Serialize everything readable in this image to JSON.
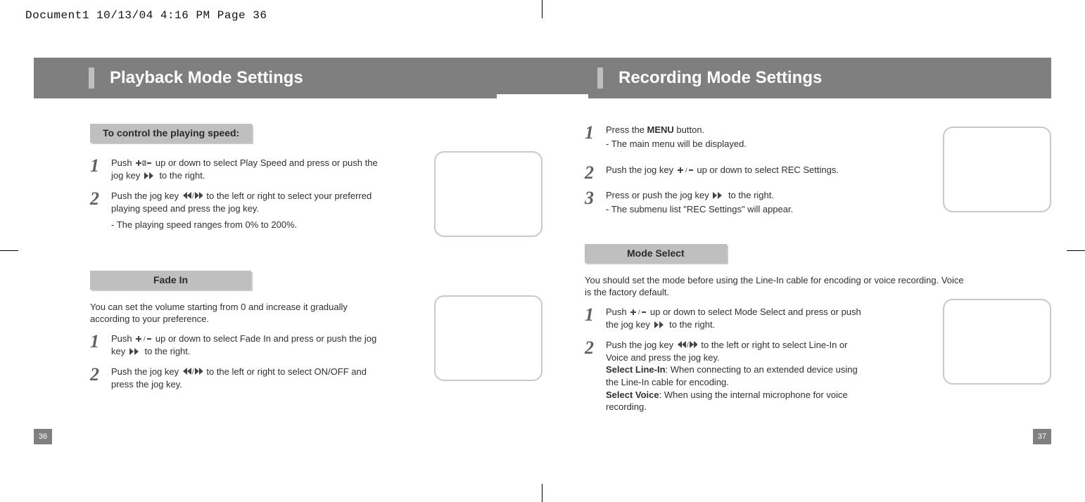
{
  "imposition_header": "Document1  10/13/04  4:16 PM  Page 36",
  "left": {
    "title": "Playback Mode Settings",
    "subhead1": "To control the playing speed:",
    "step1_num": "1",
    "step1_a": "Push ",
    "step1_b": " up or down to select Play Speed and press or push the jog key ",
    "step1_c": " to the right.",
    "step2_num": "2",
    "step2_a": "Push the jog key ",
    "step2_b": " to the left or right to select your preferred playing speed and press the jog key.",
    "step2_note": "- The playing speed ranges from 0% to 200%.",
    "subhead2": "Fade In",
    "fade_intro": "You can set the volume starting from 0 and increase it gradually according to your preference.",
    "fstep1_num": "1",
    "fstep1_a": "Push ",
    "fstep1_b": " up or down to select Fade In and press or push the jog key ",
    "fstep1_c": " to the right.",
    "fstep2_num": "2",
    "fstep2_a": "Push the jog key ",
    "fstep2_b": " to the left or right to select ON/OFF and press the jog key.",
    "page_num": "36"
  },
  "right": {
    "title": "Recording Mode Settings",
    "r1_num": "1",
    "r1_a": "Press the ",
    "r1_bold": "MENU",
    "r1_b": " button.",
    "r1_note": "- The main menu will be displayed.",
    "r2_num": "2",
    "r2_a": "Push the jog key ",
    "r2_b": " up or down to select REC Settings.",
    "r3_num": "3",
    "r3_a": "Press or push the jog key ",
    "r3_b": " to the right.",
    "r3_note": "- The submenu list \"REC Settings\" will appear.",
    "subhead1": "Mode Select",
    "mode_intro": "You should set the mode before using the Line-In cable for encoding or voice recording. Voice is the factory default.",
    "m1_num": "1",
    "m1_a": "Push ",
    "m1_b": " up or down to select Mode Select and press or push the jog key ",
    "m1_c": " to the right.",
    "m2_num": "2",
    "m2_a": "Push the jog key ",
    "m2_b": " to the left or right to select Line-In or Voice and press the jog key.",
    "m2_bold1": "Select Line-In",
    "m2_c": ": When connecting to an extended device using the Line-In cable for encoding.",
    "m2_bold2": "Select Voice",
    "m2_d": ": When using the internal microphone for voice recording.",
    "page_num": "37"
  },
  "icons": {
    "plus_minus": "plus-minus-icon",
    "ff": "fast-forward-icon",
    "rw_ff": "rewind-fastforward-icon"
  }
}
